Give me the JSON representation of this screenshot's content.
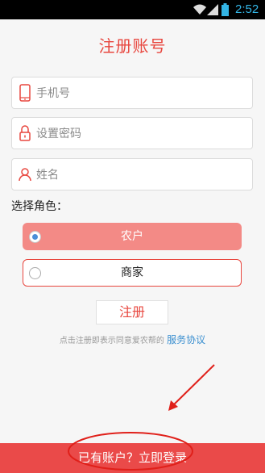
{
  "status_bar": {
    "time": "2:52",
    "icons": [
      "wifi-icon",
      "signal-icon",
      "battery-icon"
    ],
    "time_color": "#33b5e5"
  },
  "header": {
    "title": "注册账号",
    "title_color": "#e8473f"
  },
  "form": {
    "phone": {
      "placeholder": "手机号",
      "icon": "phone-icon"
    },
    "password": {
      "placeholder": "设置密码",
      "icon": "lock-icon"
    },
    "name": {
      "placeholder": "姓名",
      "icon": "person-icon"
    }
  },
  "role": {
    "label": "选择角色：",
    "options": [
      {
        "label": "农户",
        "selected": true
      },
      {
        "label": "商家",
        "selected": false
      }
    ]
  },
  "actions": {
    "register_label": "注册",
    "agreement_prefix": "点击注册即表示同意爱农帮的",
    "agreement_link": "服务协议",
    "login_prompt": "已有账户？立即登录"
  },
  "colors": {
    "accent": "#e8473f",
    "selected_role_bg": "#f38a86",
    "link": "#3a8fd0",
    "bottom_bar": "#ea4a49"
  }
}
